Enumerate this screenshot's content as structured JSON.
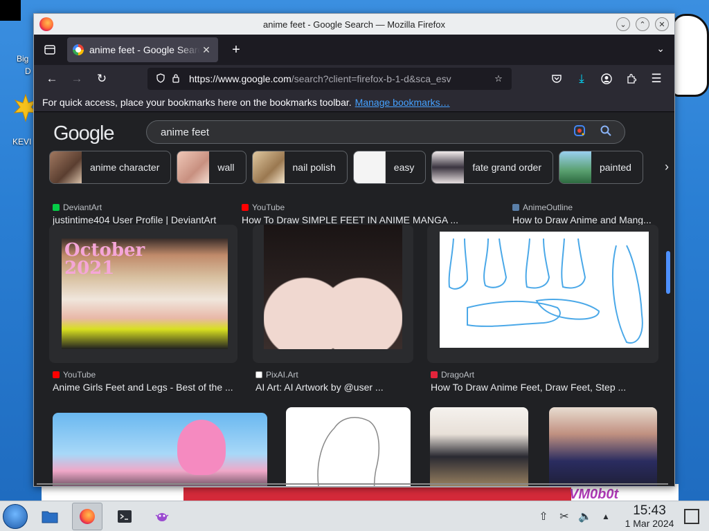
{
  "desktop": {
    "icon1_label": "Big",
    "icon1_label_2": "D",
    "icon2_label": "KEVI",
    "watermark": "VM0b0t"
  },
  "window": {
    "title": "anime feet - Google Search — Mozilla Firefox"
  },
  "tabs": [
    {
      "title": "anime feet - Google Search"
    }
  ],
  "urlbar": {
    "host": "https://www.google.com",
    "path": "/search?client=firefox-b-1-d&sca_esv"
  },
  "bookmarks_bar": {
    "message": "For quick access, place your bookmarks here on the bookmarks toolbar.",
    "link": "Manage bookmarks…"
  },
  "google": {
    "logo": "Google",
    "query": "anime feet",
    "chips": [
      {
        "label": "anime character",
        "color": "#7a5a48"
      },
      {
        "label": "wall",
        "color": "#d8a898"
      },
      {
        "label": "nail polish",
        "color": "#c4a27a"
      },
      {
        "label": "easy",
        "color": "#f2f2f2"
      },
      {
        "label": "fate grand order",
        "color": "#3a3440"
      },
      {
        "label": "painted",
        "color": "#5aa070"
      }
    ]
  },
  "results": {
    "row0": [
      {
        "source": "DeviantArt",
        "title": "justintime404 User Profile | DeviantArt",
        "fav_color": "#05cc47"
      },
      {
        "source": "YouTube",
        "title": "How To Draw SIMPLE FEET IN ANIME MANGA ...",
        "fav_color": "#ff0000"
      },
      {
        "source": "AnimeOutline",
        "title": "How to Draw Anime and Mang...",
        "fav_color": "#5a7fa8"
      }
    ],
    "row1": [
      {
        "source": "YouTube",
        "title": "Anime Girls Feet and Legs - Best of the ...",
        "fav_color": "#ff0000",
        "overlay": "October\n2021"
      },
      {
        "source": "PixAI.Art",
        "title": "AI Art: AI Artwork by @user ...",
        "fav_color": "#ffffff"
      },
      {
        "source": "DragoArt",
        "title": "How To Draw Anime Feet, Draw Feet, Step ...",
        "fav_color": "#e3243b"
      }
    ]
  },
  "taskbar": {
    "time": "15:43",
    "date": "1 Mar 2024"
  }
}
